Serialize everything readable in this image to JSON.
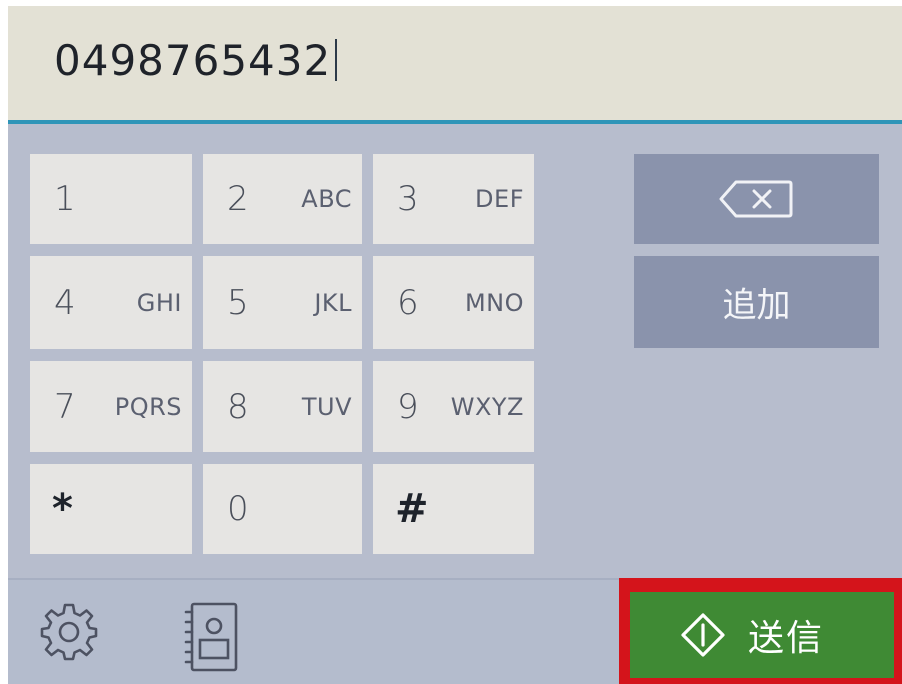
{
  "input": {
    "value": "0498765432"
  },
  "keypad": {
    "keys": [
      {
        "digit": "1",
        "letters": ""
      },
      {
        "digit": "2",
        "letters": "ABC"
      },
      {
        "digit": "3",
        "letters": "DEF"
      },
      {
        "digit": "4",
        "letters": "GHI"
      },
      {
        "digit": "5",
        "letters": "JKL"
      },
      {
        "digit": "6",
        "letters": "MNO"
      },
      {
        "digit": "7",
        "letters": "PQRS"
      },
      {
        "digit": "8",
        "letters": "TUV"
      },
      {
        "digit": "9",
        "letters": "WXYZ"
      },
      {
        "digit": "*",
        "letters": ""
      },
      {
        "digit": "0",
        "letters": ""
      },
      {
        "digit": "#",
        "letters": ""
      }
    ]
  },
  "side": {
    "backspace_icon": "backspace-icon",
    "add_label": "追加"
  },
  "toolbar": {
    "settings_icon": "gear-icon",
    "address_book_icon": "address-book-icon",
    "send_icon": "start-diamond-icon",
    "send_label": "送信"
  },
  "colors": {
    "header_bg": "#e3e1d5",
    "accent_line": "#2f95b8",
    "panel_bg": "#b7bdcd",
    "key_bg": "#e6e5e3",
    "side_button_bg": "#8a93ac",
    "send_bg": "#3f8a34",
    "highlight_border": "#d4141b"
  }
}
